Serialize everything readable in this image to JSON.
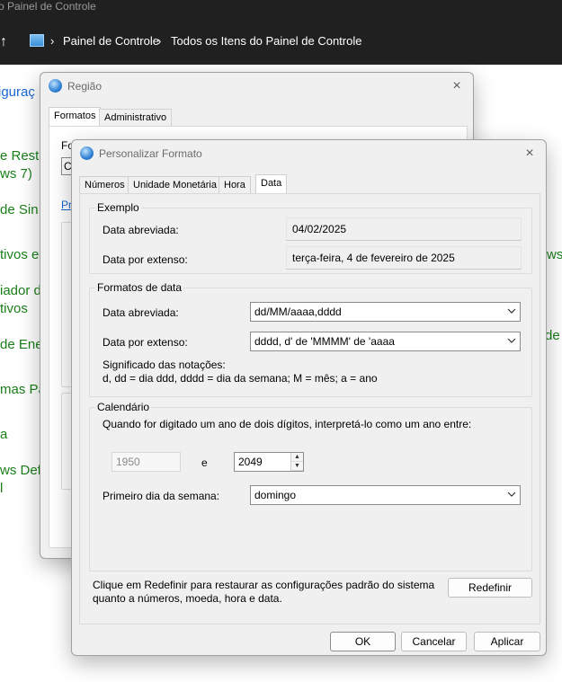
{
  "control_panel": {
    "window_title": "o Painel de Controle",
    "up_arrow": "↑",
    "breadcrumb": [
      "Painel de Controle",
      "Todos os Itens do Painel de Controle"
    ],
    "breadcrumb_sep": "›",
    "left_items": [
      "iguraç",
      "e Rest",
      "ws 7)",
      "de Sin",
      "tivos e",
      "iador d",
      "tivos",
      "de Ene",
      "mas Pa",
      "a",
      "ws Defe",
      "l"
    ],
    "right_items": [
      "ws",
      "de"
    ]
  },
  "regiao": {
    "title": "Região",
    "close": "×",
    "tabs": [
      "Formatos",
      "Administrativo"
    ],
    "partial_text": {
      "fo": "Fo",
      "formato": "Formato: Português (Brasil)",
      "c": "C",
      "pr": "Pr"
    }
  },
  "personalizar": {
    "title": "Personalizar Formato",
    "close": "×",
    "tabs": [
      "Números",
      "Unidade Monetária",
      "Hora",
      "Data"
    ],
    "exemplo": {
      "label": "Exemplo",
      "short_label": "Data abreviada:",
      "short_value": "04/02/2025",
      "long_label": "Data por extenso:",
      "long_value": "terça-feira, 4 de fevereiro de 2025"
    },
    "formatos": {
      "label": "Formatos de data",
      "short_label": "Data abreviada:",
      "short_value": "dd/MM/aaaa,dddd",
      "long_label": "Data por extenso:",
      "long_value": "dddd, d' de 'MMMM' de 'aaaa",
      "notation_title": "Significado das notações:",
      "notation_text": "d, dd = dia  ddd, dddd = dia da semana;  M = mês;  a = ano"
    },
    "calendario": {
      "label": "Calendário",
      "two_digit_text": "Quando for digitado um ano de dois dígitos, interpretá-lo como um ano entre:",
      "year_from": "1950",
      "and": "e",
      "year_to": "2049",
      "first_day_label": "Primeiro dia da semana:",
      "first_day_value": "domingo"
    },
    "reset_text_line1": "Clique em Redefinir para restaurar as configurações padrão do sistema",
    "reset_text_line2": "quanto a números, moeda, hora e data.",
    "reset_button": "Redefinir",
    "ok_button": "OK",
    "cancel_button": "Cancelar",
    "apply_button": "Aplicar"
  }
}
